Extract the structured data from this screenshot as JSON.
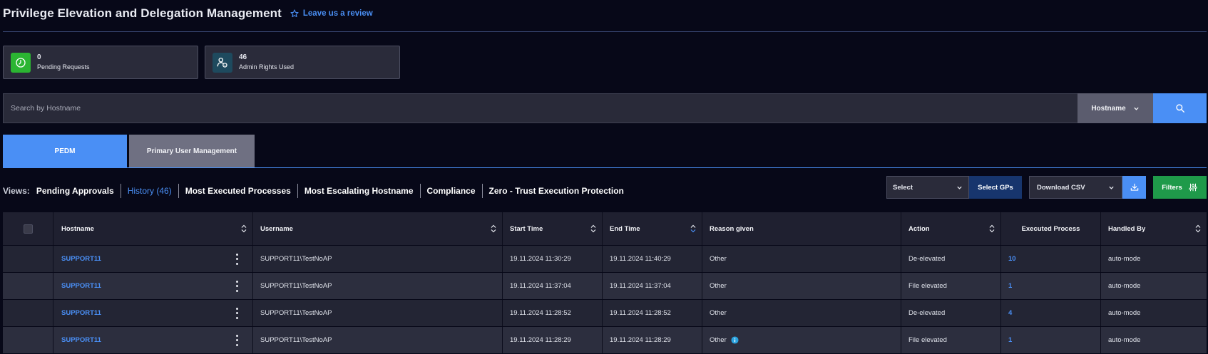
{
  "header": {
    "title": "Privilege Elevation and Delegation Management",
    "review_label": "Leave us a review"
  },
  "stats": [
    {
      "value": "0",
      "label": "Pending Requests",
      "icon": "clock-icon",
      "color": "#2bb532"
    },
    {
      "value": "46",
      "label": "Admin Rights Used",
      "icon": "admin-users-icon",
      "color": "#1e4a5e"
    }
  ],
  "search": {
    "placeholder": "Search by Hostname",
    "field": "Hostname"
  },
  "tabs": [
    {
      "label": "PEDM",
      "active": true
    },
    {
      "label": "Primary User Management",
      "active": false
    }
  ],
  "views": {
    "label": "Views:",
    "items": [
      {
        "label": "Pending Approvals",
        "active": false
      },
      {
        "label": "History (46)",
        "active": true
      },
      {
        "label": "Most Executed Processes",
        "active": false
      },
      {
        "label": "Most Escalating Hostname",
        "active": false
      },
      {
        "label": "Compliance",
        "active": false
      },
      {
        "label": "Zero - Trust Execution Protection",
        "active": false
      }
    ]
  },
  "controls": {
    "gp_select": "Select",
    "gp_button": "Select GPs",
    "csv_select": "Download CSV",
    "filters": "Filters"
  },
  "table": {
    "columns": [
      "Hostname",
      "Username",
      "Start Time",
      "End Time",
      "Reason given",
      "Action",
      "Executed Process",
      "Handled By"
    ],
    "rows": [
      {
        "hostname": "SUPPORT11",
        "username": "SUPPORT11\\TestNoAP",
        "start": "19.11.2024  11:30:29",
        "end": "19.11.2024  11:40:29",
        "reason": "Other",
        "action": "De-elevated",
        "executed": "10",
        "handled": "auto-mode"
      },
      {
        "hostname": "SUPPORT11",
        "username": "SUPPORT11\\TestNoAP",
        "start": "19.11.2024  11:37:04",
        "end": "19.11.2024  11:37:04",
        "reason": "Other",
        "action": "File elevated",
        "executed": "1",
        "handled": "auto-mode"
      },
      {
        "hostname": "SUPPORT11",
        "username": "SUPPORT11\\TestNoAP",
        "start": "19.11.2024  11:28:52",
        "end": "19.11.2024  11:28:52",
        "reason": "Other",
        "action": "De-elevated",
        "executed": "4",
        "handled": "auto-mode"
      },
      {
        "hostname": "SUPPORT11",
        "username": "SUPPORT11\\TestNoAP",
        "start": "19.11.2024  11:28:29",
        "end": "19.11.2024  11:28:29",
        "reason": "Other",
        "action": "File elevated",
        "executed": "1",
        "handled": "auto-mode"
      }
    ]
  },
  "colors": {
    "accent": "#4a8ff5",
    "success": "#1f9a4a",
    "background": "#070818"
  }
}
